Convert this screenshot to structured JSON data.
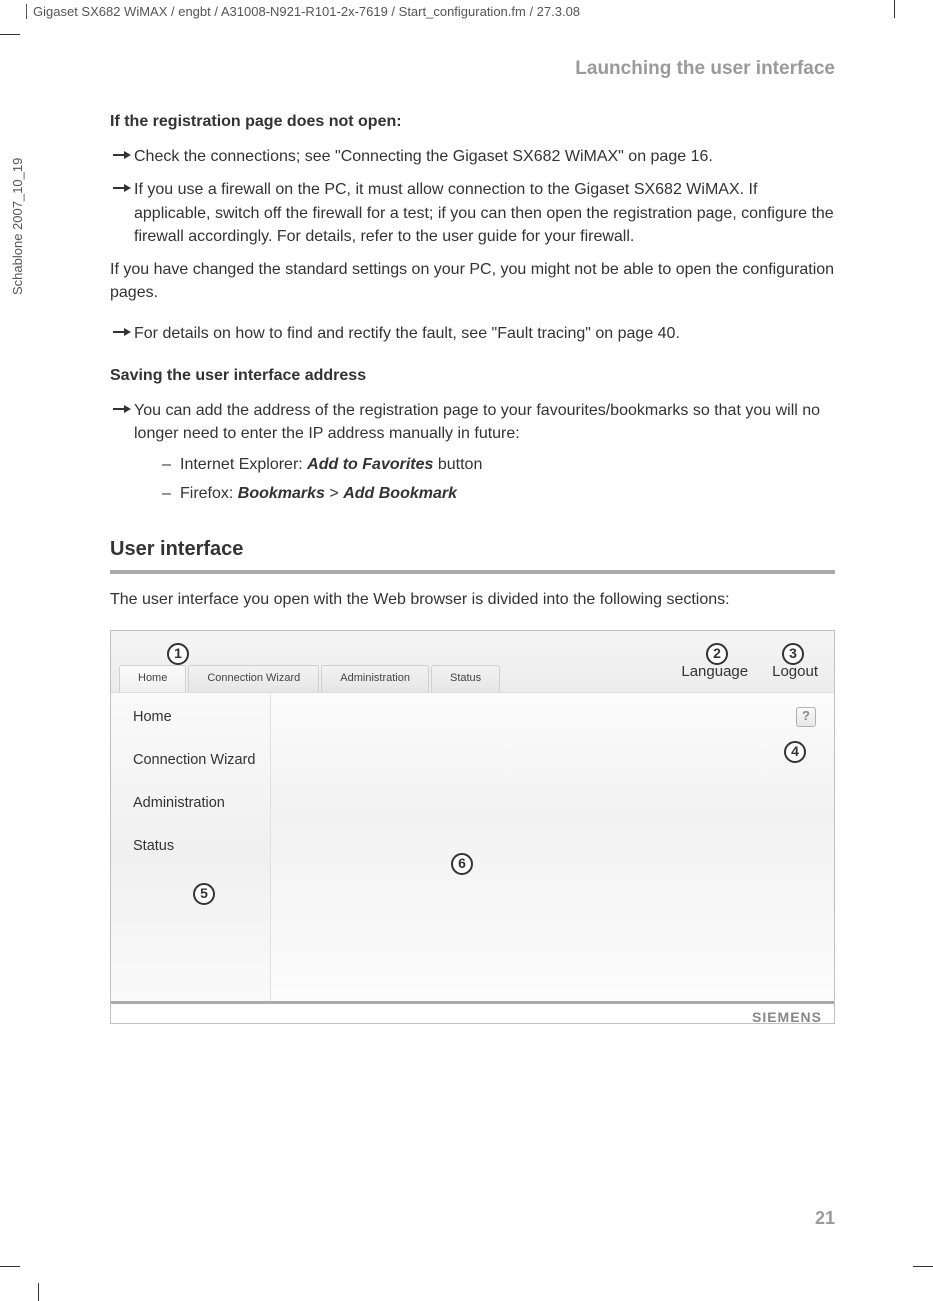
{
  "header_path": "Gigaset SX682 WiMAX / engbt / A31008-N921-R101-2x-7619 / Start_configuration.fm / 27.3.08",
  "side_text": "Schablone 2007_10_19",
  "running_head": "Launching the user interface",
  "reg_heading": "If the registration page does not open:",
  "bullet1": "Check the connections; see \"Connecting the Gigaset SX682 WiMAX\" on page 16.",
  "bullet2": "If you use a firewall on the PC, it must allow connection to the Gigaset SX682 WiMAX. If applicable, switch off the firewall for a test; if you can then open the registration page, configure the firewall accordingly. For details, refer to the user guide for your firewall.",
  "para_changed": "If you have changed the standard settings on your PC, you might not be able to open the configuration pages.",
  "bullet3": "For details on how to find and rectify the fault, see \"Fault tracing\" on page 40.",
  "save_heading": "Saving the user interface address",
  "bullet4": "You can add the address of the registration page to your favourites/bookmarks so that you will no longer need to enter the IP address manually in future:",
  "dash_ie_pre": "Internet Explorer: ",
  "dash_ie_bold": "Add to Favorites",
  "dash_ie_post": " button",
  "dash_ff_pre": "Firefox: ",
  "dash_ff_b1": "Bookmarks",
  "dash_ff_mid": " > ",
  "dash_ff_b2": "Add Bookmark",
  "ui_heading": "User interface",
  "ui_intro": "The user interface you open with the Web browser is divided into the following sections:",
  "tabs": {
    "t1": "Home",
    "t2": "Connection Wizard",
    "t3": "Administration",
    "t4": "Status"
  },
  "top_right": {
    "language": "Language",
    "logout": "Logout"
  },
  "sidebar": {
    "s1": "Home",
    "s2": "Connection Wizard",
    "s3": "Administration",
    "s4": "Status"
  },
  "help_glyph": "?",
  "brand": "SIEMENS",
  "callouts": {
    "c1": "1",
    "c2": "2",
    "c3": "3",
    "c4": "4",
    "c5": "5",
    "c6": "6"
  },
  "page_number": "21"
}
